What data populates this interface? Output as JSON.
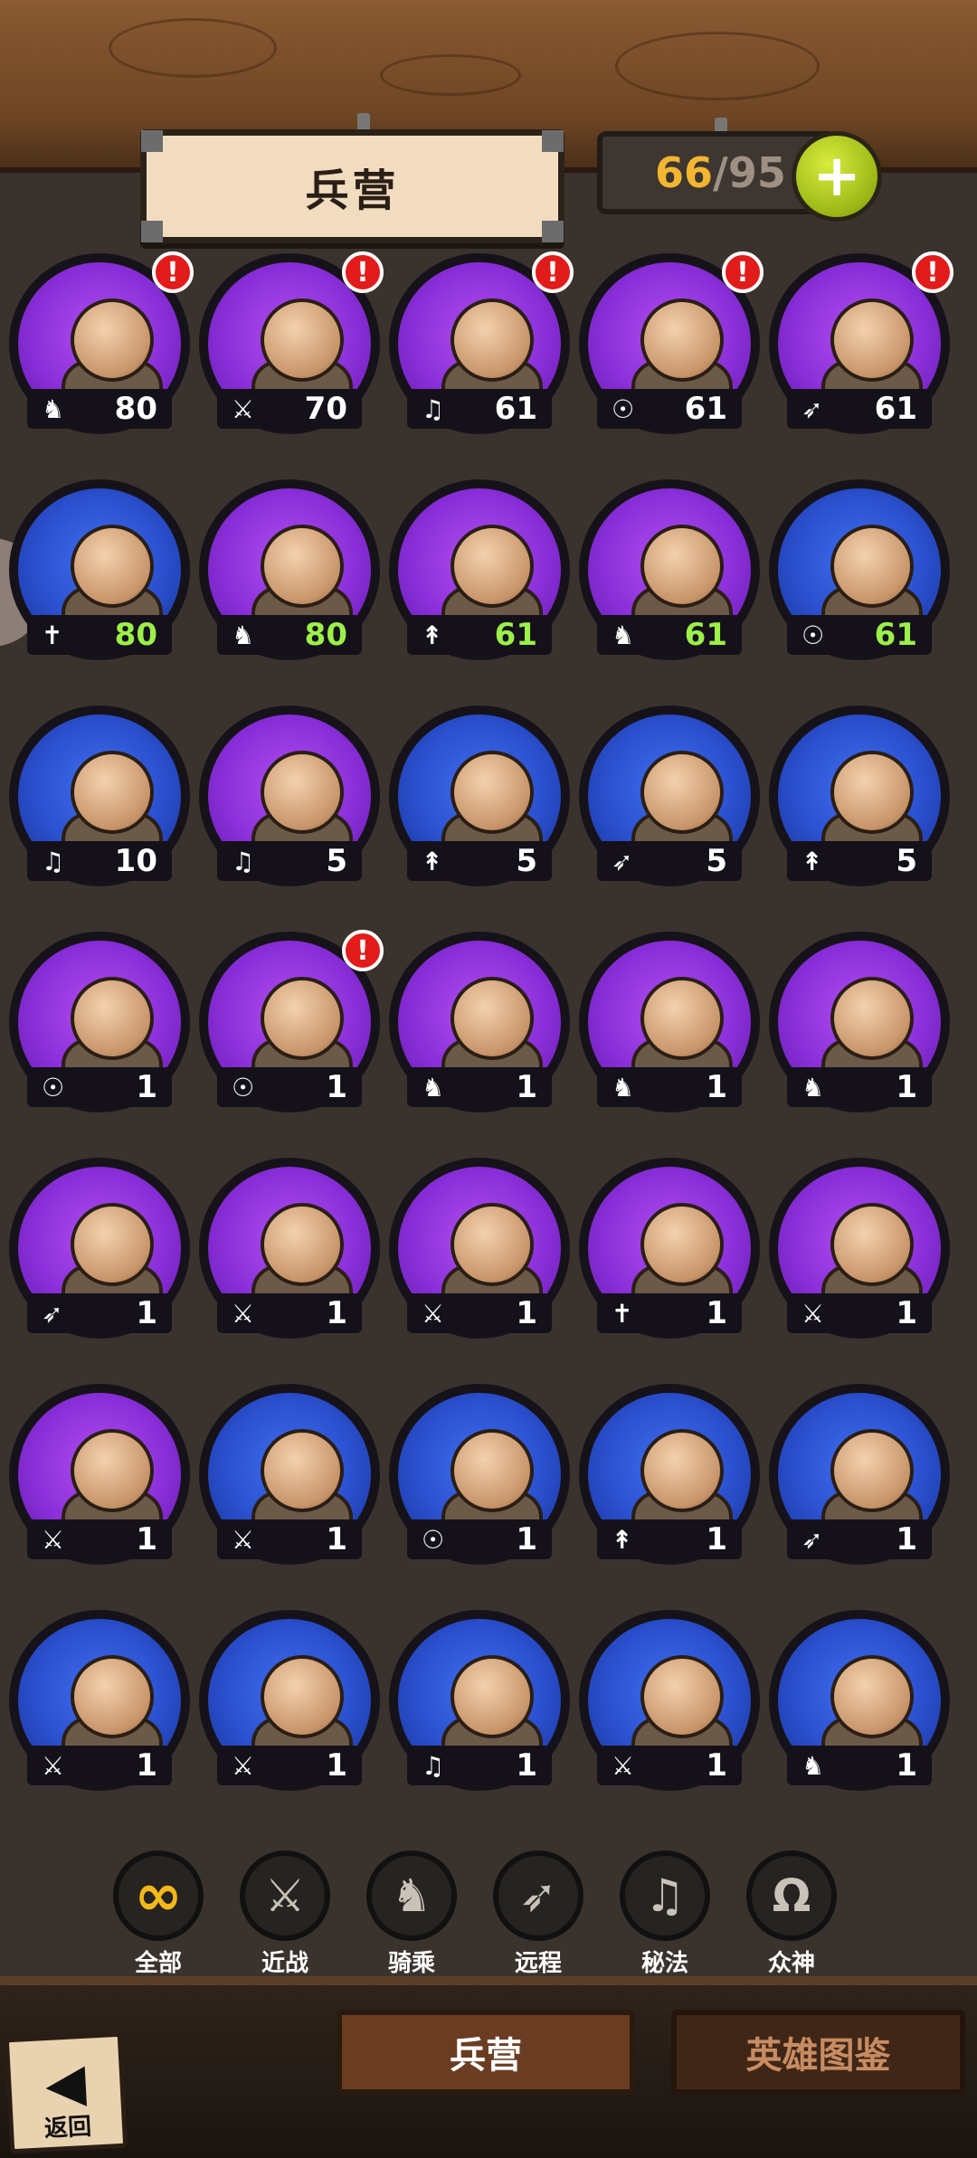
{
  "header": {
    "title": "兵营",
    "count_current": "66",
    "count_sep": "/",
    "count_max": "95",
    "plus_label": "+"
  },
  "colors": {
    "purple_rarity": "#8a2fd9",
    "blue_rarity": "#2a4fcd",
    "level_green": "#9cf04a",
    "alert_red": "#e21b1b",
    "count_gold": "#f2b632"
  },
  "units": [
    {
      "rarity": "purple",
      "type": "cavalry",
      "icon": "horse-icon",
      "level": "80",
      "green": false,
      "alert": true
    },
    {
      "rarity": "purple",
      "type": "melee",
      "icon": "sword-icon",
      "level": "70",
      "green": false,
      "alert": true
    },
    {
      "rarity": "purple",
      "type": "arcane",
      "icon": "magic-icon",
      "level": "61",
      "green": false,
      "alert": true
    },
    {
      "rarity": "purple",
      "type": "divine",
      "icon": "god-icon",
      "level": "61",
      "green": false,
      "alert": true
    },
    {
      "rarity": "purple",
      "type": "ranged",
      "icon": "bow-icon",
      "level": "61",
      "green": false,
      "alert": true
    },
    {
      "rarity": "blue",
      "type": "healer",
      "icon": "cross-icon",
      "level": "80",
      "green": true,
      "alert": false
    },
    {
      "rarity": "purple",
      "type": "cavalry",
      "icon": "horse-icon",
      "level": "80",
      "green": true,
      "alert": false
    },
    {
      "rarity": "purple",
      "type": "spear",
      "icon": "spear-icon",
      "level": "61",
      "green": true,
      "alert": false
    },
    {
      "rarity": "purple",
      "type": "cavalry",
      "icon": "horse-icon",
      "level": "61",
      "green": true,
      "alert": false
    },
    {
      "rarity": "blue",
      "type": "divine",
      "icon": "god-icon",
      "level": "61",
      "green": true,
      "alert": false
    },
    {
      "rarity": "blue",
      "type": "arcane",
      "icon": "magic-icon",
      "level": "10",
      "green": false,
      "alert": false
    },
    {
      "rarity": "purple",
      "type": "arcane",
      "icon": "magic-icon",
      "level": "5",
      "green": false,
      "alert": false
    },
    {
      "rarity": "blue",
      "type": "spear",
      "icon": "spear-icon",
      "level": "5",
      "green": false,
      "alert": false
    },
    {
      "rarity": "blue",
      "type": "ranged",
      "icon": "bow-icon",
      "level": "5",
      "green": false,
      "alert": false
    },
    {
      "rarity": "blue",
      "type": "spear",
      "icon": "spear-icon",
      "level": "5",
      "green": false,
      "alert": false
    },
    {
      "rarity": "purple",
      "type": "divine",
      "icon": "god-icon",
      "level": "1",
      "green": false,
      "alert": false
    },
    {
      "rarity": "purple",
      "type": "divine",
      "icon": "god-icon",
      "level": "1",
      "green": false,
      "alert": true
    },
    {
      "rarity": "purple",
      "type": "cavalry",
      "icon": "horse-icon",
      "level": "1",
      "green": false,
      "alert": false
    },
    {
      "rarity": "purple",
      "type": "cavalry",
      "icon": "horse-icon",
      "level": "1",
      "green": false,
      "alert": false
    },
    {
      "rarity": "purple",
      "type": "cavalry",
      "icon": "horse-icon",
      "level": "1",
      "green": false,
      "alert": false
    },
    {
      "rarity": "purple",
      "type": "ranged",
      "icon": "bow-icon",
      "level": "1",
      "green": false,
      "alert": false
    },
    {
      "rarity": "purple",
      "type": "melee",
      "icon": "sword-icon",
      "level": "1",
      "green": false,
      "alert": false
    },
    {
      "rarity": "purple",
      "type": "melee",
      "icon": "sword-icon",
      "level": "1",
      "green": false,
      "alert": false
    },
    {
      "rarity": "purple",
      "type": "healer",
      "icon": "cross-icon",
      "level": "1",
      "green": false,
      "alert": false
    },
    {
      "rarity": "purple",
      "type": "melee",
      "icon": "sword-icon",
      "level": "1",
      "green": false,
      "alert": false
    },
    {
      "rarity": "purple",
      "type": "melee",
      "icon": "sword-icon",
      "level": "1",
      "green": false,
      "alert": false
    },
    {
      "rarity": "blue",
      "type": "melee",
      "icon": "sword-icon",
      "level": "1",
      "green": false,
      "alert": false
    },
    {
      "rarity": "blue",
      "type": "divine",
      "icon": "god-icon",
      "level": "1",
      "green": false,
      "alert": false
    },
    {
      "rarity": "blue",
      "type": "spear",
      "icon": "spear-icon",
      "level": "1",
      "green": false,
      "alert": false
    },
    {
      "rarity": "blue",
      "type": "ranged",
      "icon": "bow-icon",
      "level": "1",
      "green": false,
      "alert": false
    },
    {
      "rarity": "blue",
      "type": "melee",
      "icon": "sword-icon",
      "level": "1",
      "green": false,
      "alert": false
    },
    {
      "rarity": "blue",
      "type": "melee",
      "icon": "sword-icon",
      "level": "1",
      "green": false,
      "alert": false
    },
    {
      "rarity": "blue",
      "type": "arcane",
      "icon": "magic-icon",
      "level": "1",
      "green": false,
      "alert": false
    },
    {
      "rarity": "blue",
      "type": "melee",
      "icon": "sword-icon",
      "level": "1",
      "green": false,
      "alert": false
    },
    {
      "rarity": "blue",
      "type": "cavalry",
      "icon": "horse-icon",
      "level": "1",
      "green": false,
      "alert": false
    }
  ],
  "filters": [
    {
      "label": "全部",
      "icon": "infinity-icon",
      "active": true
    },
    {
      "label": "近战",
      "icon": "sword-icon",
      "active": false
    },
    {
      "label": "骑乘",
      "icon": "horse-icon",
      "active": false
    },
    {
      "label": "远程",
      "icon": "bow-icon",
      "active": false
    },
    {
      "label": "秘法",
      "icon": "magic-icon",
      "active": false
    },
    {
      "label": "众神",
      "icon": "omega-icon",
      "active": false
    }
  ],
  "bottom": {
    "back_label": "返回",
    "tab_barracks": "兵营",
    "tab_gallery": "英雄图鉴"
  }
}
